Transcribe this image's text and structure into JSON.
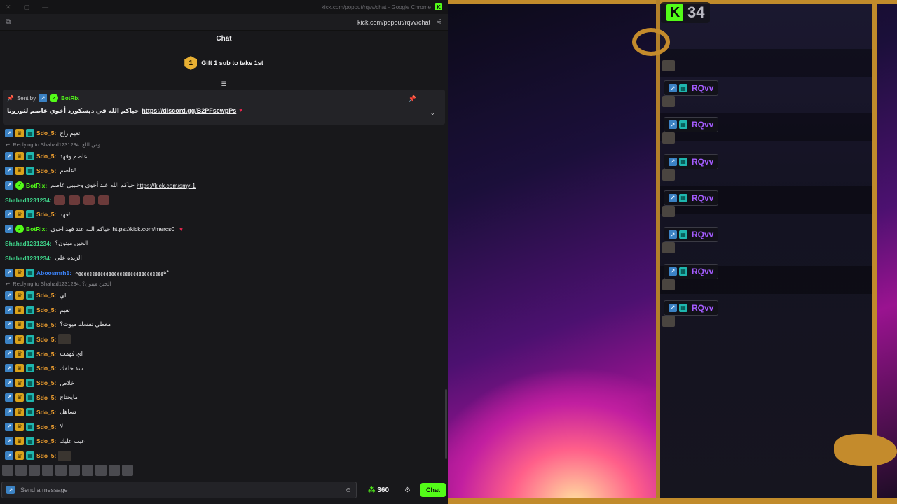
{
  "browser": {
    "window_title": "kick.com/popout/rqvv/chat - Google Chrome",
    "address": "kick.com/popout/rqvv/chat"
  },
  "chat": {
    "title": "Chat",
    "gift_rank": "1",
    "gift_text": "Gift 1 sub to take 1st",
    "pinned": {
      "sent_by_label": "Sent by",
      "sender": "BotRix",
      "text": "حياكم الله في ديسكورد أخوي عاصم لتورونا",
      "link": "https://discord.gg/B2PFsewpPs"
    },
    "messages": [
      {
        "type": "msg",
        "badges": [
          "arrow",
          "crown",
          "sub"
        ],
        "user": "Sdo_5",
        "color": "#f0a030",
        "text": "نعيم راح"
      },
      {
        "type": "reply",
        "text": "Replying to Shahad1231234: ومن اللع"
      },
      {
        "type": "msg",
        "badges": [
          "arrow",
          "crown",
          "sub"
        ],
        "user": "Sdo_5",
        "color": "#f0a030",
        "text": "عاصم وفهد"
      },
      {
        "type": "msg",
        "badges": [
          "arrow",
          "crown",
          "sub"
        ],
        "user": "Sdo_5",
        "color": "#f0a030",
        "text": "عاصم!"
      },
      {
        "type": "msg",
        "badges": [
          "arrow",
          "ver"
        ],
        "user": "BotRix",
        "color": "#53fc18",
        "text": "حياكم الله عند أخوي وحبيبي عاصم",
        "link": "https://kick.com/smy-1"
      },
      {
        "type": "msg",
        "badges": [],
        "user": "Shahad1231234",
        "color": "#3fd38a",
        "emotes": 4
      },
      {
        "type": "msg",
        "badges": [
          "arrow",
          "crown",
          "sub"
        ],
        "user": "Sdo_5",
        "color": "#f0a030",
        "text": "فهد!"
      },
      {
        "type": "msg",
        "badges": [
          "arrow",
          "ver"
        ],
        "user": "BotRix",
        "color": "#53fc18",
        "text": "حياكم الله عند فهد اخوي",
        "link": "https://kick.com/mercs0",
        "heart": true
      },
      {
        "type": "msg",
        "badges": [],
        "user": "Shahad1231234",
        "color": "#3fd38a",
        "text": "الحين ميتون؟"
      },
      {
        "type": "msg",
        "badges": [],
        "user": "Shahad1231234",
        "color": "#3fd38a",
        "text": "الزبده على"
      },
      {
        "type": "msg",
        "badges": [
          "arrow",
          "crown",
          "sub"
        ],
        "user": "Aboosmrh1",
        "color": "#3b82f6",
        "text": "ههههههههههههههههههههههههههههههههه*"
      },
      {
        "type": "reply",
        "text": "Replying to Shahad1231234: الحين ميتون؟"
      },
      {
        "type": "msg",
        "badges": [
          "arrow",
          "crown",
          "sub"
        ],
        "user": "Sdo_5",
        "color": "#f0a030",
        "text": "اي"
      },
      {
        "type": "msg",
        "badges": [
          "arrow",
          "crown",
          "sub"
        ],
        "user": "Sdo_5",
        "color": "#f0a030",
        "text": "نعيم"
      },
      {
        "type": "msg",
        "badges": [
          "arrow",
          "crown",
          "sub"
        ],
        "user": "Sdo_5",
        "color": "#f0a030",
        "text": "معطي نفسك ميوت؟"
      },
      {
        "type": "msg",
        "badges": [
          "arrow",
          "crown",
          "sub"
        ],
        "user": "Sdo_5",
        "color": "#f0a030",
        "thumb": true
      },
      {
        "type": "msg",
        "badges": [
          "arrow",
          "crown",
          "sub"
        ],
        "user": "Sdo_5",
        "color": "#f0a030",
        "text": "اي فهمت"
      },
      {
        "type": "msg",
        "badges": [
          "arrow",
          "crown",
          "sub"
        ],
        "user": "Sdo_5",
        "color": "#f0a030",
        "text": "سد حلقك"
      },
      {
        "type": "msg",
        "badges": [
          "arrow",
          "crown",
          "sub"
        ],
        "user": "Sdo_5",
        "color": "#f0a030",
        "text": "خلاص"
      },
      {
        "type": "msg",
        "badges": [
          "arrow",
          "crown",
          "sub"
        ],
        "user": "Sdo_5",
        "color": "#f0a030",
        "text": "مايحتاج"
      },
      {
        "type": "msg",
        "badges": [
          "arrow",
          "crown",
          "sub"
        ],
        "user": "Sdo_5",
        "color": "#f0a030",
        "text": "تساهل"
      },
      {
        "type": "msg",
        "badges": [
          "arrow",
          "crown",
          "sub"
        ],
        "user": "Sdo_5",
        "color": "#f0a030",
        "text": "لا"
      },
      {
        "type": "msg",
        "badges": [
          "arrow",
          "crown",
          "sub"
        ],
        "user": "Sdo_5",
        "color": "#f0a030",
        "text": "عيب عليك"
      },
      {
        "type": "msg",
        "badges": [
          "arrow",
          "crown",
          "sub"
        ],
        "user": "Sdo_5",
        "color": "#f0a030",
        "thumb": true
      }
    ],
    "input_placeholder": "Send a message",
    "points": "360",
    "send_label": "Chat"
  },
  "stream": {
    "viewer_count": "34",
    "tag_name": "RQvv",
    "tag_count": 7
  },
  "colors": {
    "brand": "#53fc18",
    "gold": "#c18b2b",
    "purple_name": "#a55cff"
  }
}
